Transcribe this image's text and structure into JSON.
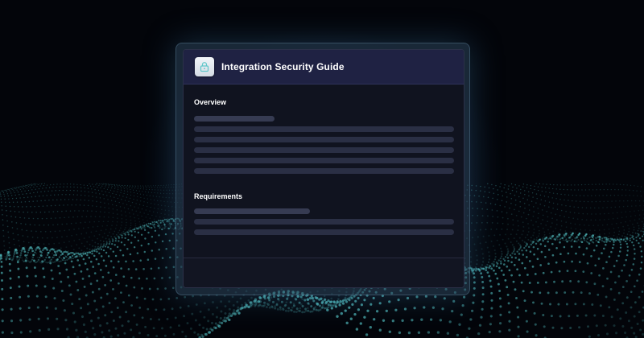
{
  "card": {
    "title": "Integration Security Guide",
    "icon": "lock-icon",
    "accent_color": "#5fc6c9"
  },
  "sections": [
    {
      "heading": "Overview"
    },
    {
      "heading": "Requirements"
    }
  ]
}
